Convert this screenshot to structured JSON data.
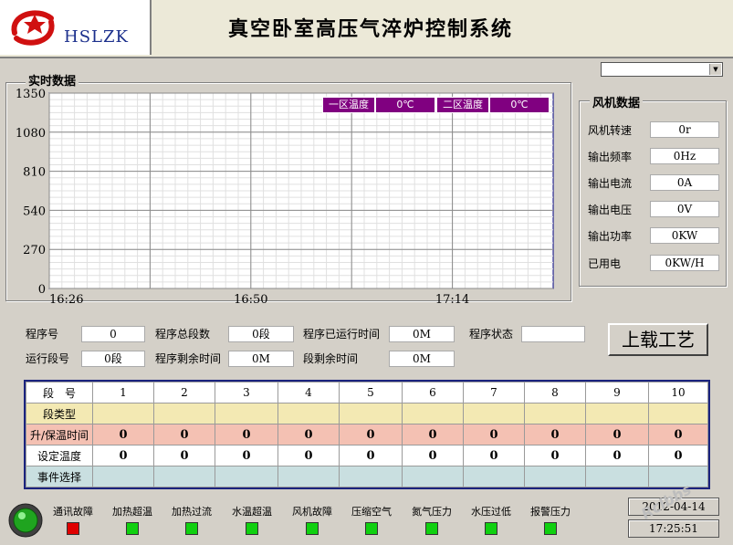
{
  "header": {
    "logo_text": "HSLZK",
    "title": "真空卧室高压气淬炉控制系统"
  },
  "realtime": {
    "group_label": "实时数据",
    "legend": {
      "zone1_label": "一区温度",
      "zone1_value": "0℃",
      "zone2_label": "二区温度",
      "zone2_value": "0℃"
    }
  },
  "chart_data": {
    "type": "line",
    "x_ticks": [
      "16:26",
      "16:50",
      "17:14"
    ],
    "y_ticks": [
      0,
      270,
      540,
      810,
      1080,
      1350
    ],
    "ylim": [
      0,
      1350
    ],
    "grid": true,
    "series": [
      {
        "name": "一区温度",
        "values": []
      },
      {
        "name": "二区温度",
        "values": []
      }
    ]
  },
  "fan": {
    "group_label": "风机数据",
    "rows": [
      {
        "label": "风机转速",
        "value": "0r"
      },
      {
        "label": "输出频率",
        "value": "0Hz"
      },
      {
        "label": "输出电流",
        "value": "0A"
      },
      {
        "label": "输出电压",
        "value": "0V"
      },
      {
        "label": "输出功率",
        "value": "0KW"
      },
      {
        "label": "已用电",
        "value": "0KW/H"
      }
    ]
  },
  "program": {
    "program_no_label": "程序号",
    "program_no": "0",
    "total_segments_label": "程序总段数",
    "total_segments": "0段",
    "elapsed_label": "程序已运行时间",
    "elapsed": "0M",
    "status_label": "程序状态",
    "status": "",
    "running_seg_label": "运行段号",
    "running_seg": "0段",
    "remaining_label": "程序剩余时间",
    "remaining": "0M",
    "seg_remaining_label": "段剩余时间",
    "seg_remaining": "0M",
    "upload_button": "上载工艺"
  },
  "segments": {
    "header_label": "段　号",
    "columns": [
      "1",
      "2",
      "3",
      "4",
      "5",
      "6",
      "7",
      "8",
      "9",
      "10"
    ],
    "rows": [
      {
        "label": "段类型",
        "values": [
          "",
          "",
          "",
          "",
          "",
          "",
          "",
          "",
          "",
          ""
        ]
      },
      {
        "label": "升/保温时间",
        "values": [
          "0",
          "0",
          "0",
          "0",
          "0",
          "0",
          "0",
          "0",
          "0",
          "0"
        ]
      },
      {
        "label": "设定温度",
        "values": [
          "0",
          "0",
          "0",
          "0",
          "0",
          "0",
          "0",
          "0",
          "0",
          "0"
        ]
      },
      {
        "label": "事件选择",
        "values": [
          "",
          "",
          "",
          "",
          "",
          "",
          "",
          "",
          "",
          ""
        ]
      }
    ]
  },
  "alarms": [
    {
      "label": "通讯故障",
      "color": "#e00000"
    },
    {
      "label": "加热超温",
      "color": "#10d010"
    },
    {
      "label": "加热过流",
      "color": "#10d010"
    },
    {
      "label": "水温超温",
      "color": "#10d010"
    },
    {
      "label": "风机故障",
      "color": "#10d010"
    },
    {
      "label": "压缩空气",
      "color": "#10d010"
    },
    {
      "label": "氮气压力",
      "color": "#10d010"
    },
    {
      "label": "水压过低",
      "color": "#10d010"
    },
    {
      "label": "报警压力",
      "color": "#10d010"
    }
  ],
  "datetime": {
    "date": "2012-04-14",
    "time": "17:25:51"
  },
  "watermark": "Rclbbs"
}
